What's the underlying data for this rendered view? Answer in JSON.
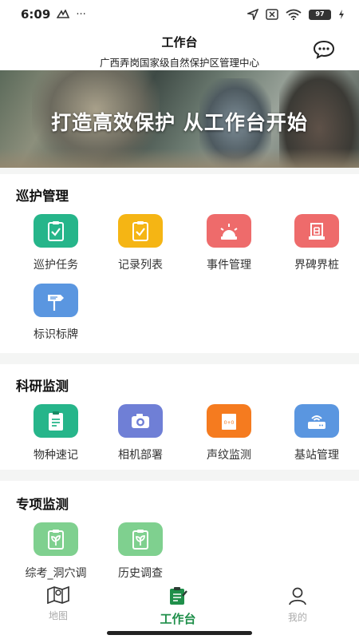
{
  "status_bar": {
    "time": "6:09",
    "dots": "···",
    "battery": "97"
  },
  "header": {
    "title": "工作台",
    "subtitle": "广西弄岗国家级自然保护区管理中心"
  },
  "banner": {
    "slogan": "打造高效保护 从工作台开始"
  },
  "sections": [
    {
      "title": "巡护管理",
      "items": [
        {
          "label": "巡护任务",
          "icon": "clipboard-check-icon",
          "color": "#26b58a"
        },
        {
          "label": "记录列表",
          "icon": "clipboard-check-icon",
          "color": "#f5b514"
        },
        {
          "label": "事件管理",
          "icon": "alarm-light-icon",
          "color": "#ee6b6b"
        },
        {
          "label": "界碑界桩",
          "icon": "boundary-marker-icon",
          "color": "#ee6b6b"
        },
        {
          "label": "标识标牌",
          "icon": "signpost-icon",
          "color": "#5a96e0"
        }
      ]
    },
    {
      "title": "科研监测",
      "items": [
        {
          "label": "物种速记",
          "icon": "clipboard-edit-icon",
          "color": "#26b58a"
        },
        {
          "label": "相机部署",
          "icon": "camera-icon",
          "color": "#6f7fd6"
        },
        {
          "label": "声纹监测",
          "icon": "sound-recorder-icon",
          "color": "#f57b1f"
        },
        {
          "label": "基站管理",
          "icon": "router-icon",
          "color": "#5a96e0"
        }
      ]
    },
    {
      "title": "专项监测",
      "items": [
        {
          "label": "综考_洞穴调",
          "icon": "plant-clipboard-icon",
          "color": "#7fd08f"
        },
        {
          "label": "历史调查",
          "icon": "plant-clipboard-icon",
          "color": "#7fd08f"
        }
      ]
    }
  ],
  "tabs": [
    {
      "label": "地图",
      "icon": "map-icon"
    },
    {
      "label": "工作台",
      "icon": "clipboard-icon",
      "active": true
    },
    {
      "label": "我的",
      "icon": "user-icon"
    }
  ]
}
